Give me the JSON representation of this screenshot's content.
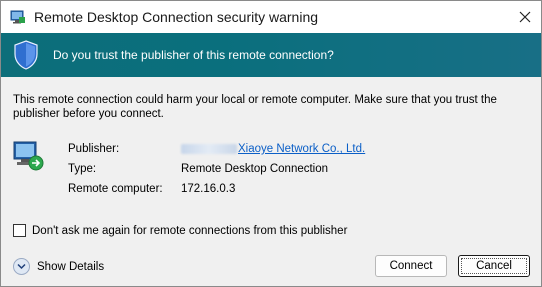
{
  "window": {
    "title": "Remote Desktop Connection security warning",
    "close_icon": "close-icon"
  },
  "banner": {
    "question": "Do you trust the publisher of this remote connection?"
  },
  "warning_text": "This remote connection could harm your local or remote computer. Make sure that you trust the publisher before you connect.",
  "details": {
    "publisher_label": "Publisher:",
    "publisher_value": "Xiaoye Network Co., Ltd.",
    "type_label": "Type:",
    "type_value": "Remote Desktop Connection",
    "remote_label": "Remote computer:",
    "remote_value": "172.16.0.3"
  },
  "checkbox": {
    "label": "Don't ask me again for remote connections from this publisher",
    "checked": false
  },
  "show_details": "Show Details",
  "buttons": {
    "connect": "Connect",
    "cancel": "Cancel"
  },
  "colors": {
    "banner": "#0d6e7a",
    "link": "#0b5fc7"
  }
}
